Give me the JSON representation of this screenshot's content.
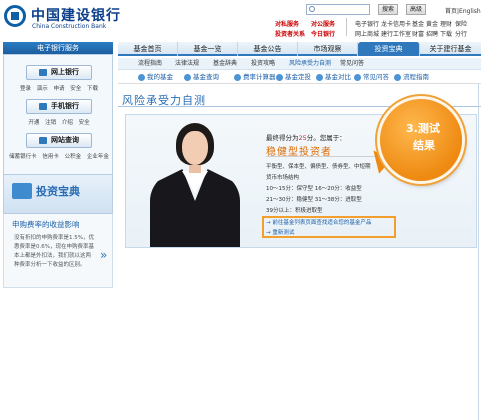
{
  "header": {
    "logo_cn": "中国建设银行",
    "logo_en": "China Construction Bank",
    "search_button": "搜索",
    "advanced_button": "高级",
    "home_link": "首页|English",
    "promo": [
      "对私服务",
      "对公服务",
      "投资者关系",
      "今日银行"
    ],
    "links_row1": [
      "电子银行",
      "龙卡信用卡",
      "基金",
      "黄金",
      "理财",
      "保险"
    ],
    "links_row2": [
      "网上商城",
      "建行工作室",
      "财富",
      "招聘",
      "下载",
      "分行"
    ]
  },
  "topnav": {
    "tabs": [
      "基金首页",
      "基金一览",
      "基金公告",
      "市场观察",
      "投资宝典",
      "关于建行基金"
    ],
    "active_index": 4
  },
  "subnav": {
    "items": [
      "流程指南",
      "法律法规",
      "基金辞典",
      "投资攻略",
      "风险承受力自测",
      "常见问答"
    ],
    "active_index": 4
  },
  "actionbar": {
    "items": [
      "我的基金",
      "基金查询",
      "费率计算器",
      "基金定投",
      "基金对比",
      "常见问答",
      "流程指南"
    ]
  },
  "sidebar": {
    "title": "电子银行服务",
    "online_bank": "网上银行",
    "online_links": [
      "登录",
      "演示",
      "申请",
      "安全",
      "下载"
    ],
    "mobile_bank": "手机银行",
    "mobile_links": [
      "开通",
      "注销",
      "介绍",
      "安全"
    ],
    "site_query": "网站查询",
    "site_links": [
      "储蓄银行卡",
      "信用卡",
      "公积金",
      "企业年金"
    ]
  },
  "baodian": {
    "title": "投资宝典",
    "headline": "申购费率的收益影响",
    "text": "没有折扣的申购费率是1.5%，优惠费率是0.6%，现在申购费率基本上都是外扣法，我们就以这两种费率分析一下收益的区别。"
  },
  "main": {
    "page_title": "风险承受力自测",
    "score_prefix": "最终得分为",
    "score_value": "25",
    "score_suffix": "分。您属于：",
    "investor_type": "稳健型投资者",
    "desc_lines": [
      "平衡型、保本型、偏债型、债券型、中短期",
      "货币市场结构",
      "10～15分：保守型   16～20分：收益型",
      "21～30分：稳健型   31～38分：进取型",
      "39分以上：积极进取型"
    ],
    "link1": "→ 前往基金列表页面查找适合您的基金产品",
    "link2": "→ 重新测试",
    "callout_line1": "3.测试",
    "callout_line2": "结果"
  }
}
